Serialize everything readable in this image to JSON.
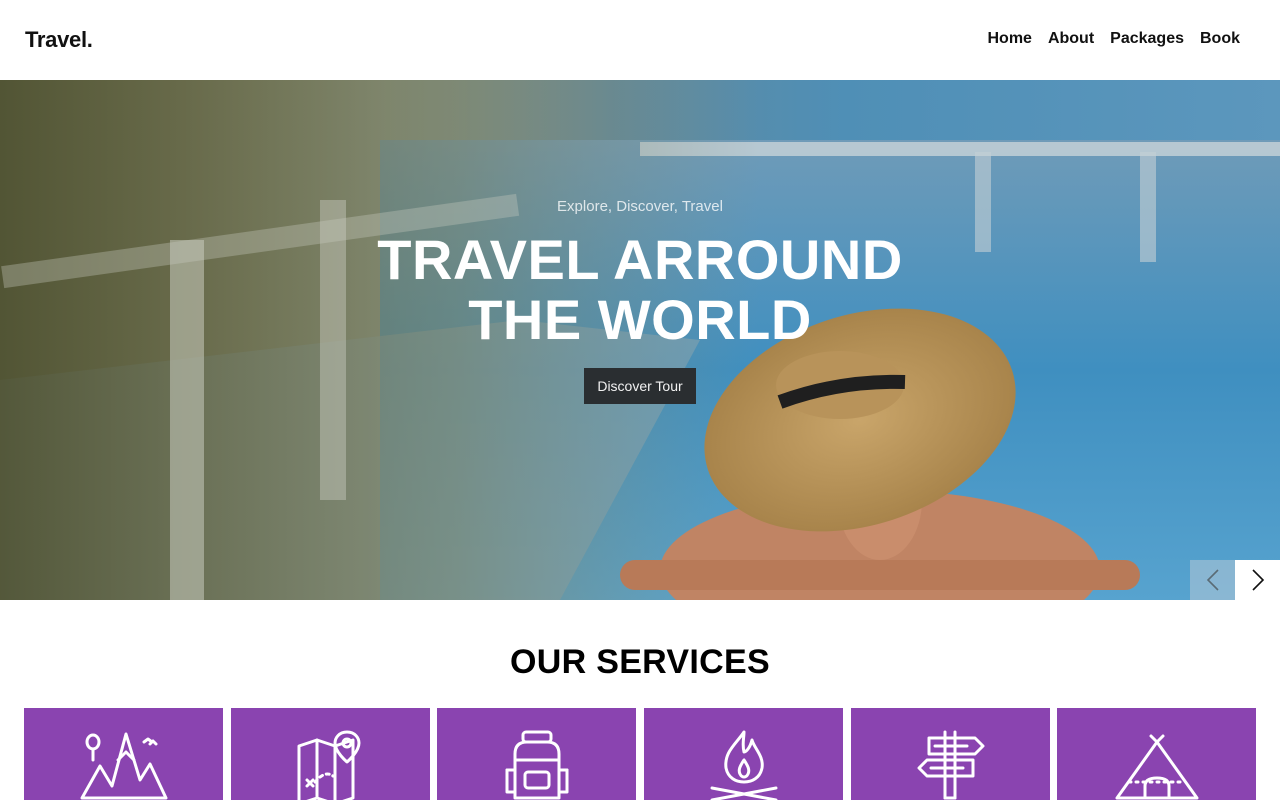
{
  "header": {
    "brand": "Travel.",
    "nav": [
      "Home",
      "About",
      "Packages",
      "Book"
    ]
  },
  "hero": {
    "subtitle": "Explore, Discover, Travel",
    "title_line1": "TRAVEL ARROUND",
    "title_line2": "THE WORLD",
    "button_label": "Discover Tour"
  },
  "services": {
    "title": "OUR SERVICES",
    "cards": [
      {
        "icon": "mountain-icon"
      },
      {
        "icon": "map-location-icon"
      },
      {
        "icon": "backpack-icon"
      },
      {
        "icon": "campfire-icon"
      },
      {
        "icon": "signpost-icon"
      },
      {
        "icon": "tent-icon"
      }
    ]
  },
  "colors": {
    "accent": "#8a44b0",
    "button_bg": "#2a2e31"
  }
}
